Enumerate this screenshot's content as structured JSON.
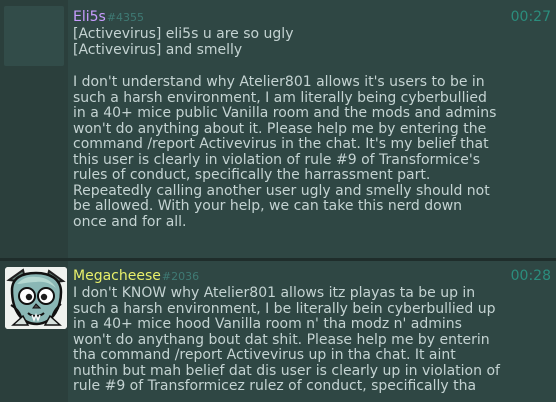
{
  "posts": [
    {
      "author": "Eli5s",
      "user_id": "#4355",
      "time": "00:27",
      "quotes": [
        "[Activevirus] eli5s u are so ugly",
        "[Activevirus] and smelly"
      ],
      "body": "I don't understand why Atelier801 allows it's users to be in\nsuch a harsh environment, I am literally being cyberbullied\nin a 40+ mice public Vanilla room and the mods and admins\nwon't do anything about it. Please help me by entering the\ncommand /report Activevirus in the chat. It's my belief that\nthis user is clearly in violation of rule #9 of Transformice's\nrules of conduct, specifically the harrassment part.\nRepeatedly calling another user ugly and smelly should not\nbe allowed. With your help, we can take this nerd down\nonce and for all."
    },
    {
      "author": "Megacheese",
      "user_id": "#2036",
      "time": "00:28",
      "body": "I don't KNOW why Atelier801 allows itz playas ta be up in\nsuch a harsh environment, I be literally bein cyberbullied up\nin a 40+ mice hood Vanilla room n' tha modz n' admins\nwon't do anythang bout dat shit. Please help me by enterin\ntha command /report Activevirus up in tha chat. It aint\nnuthin but mah belief dat dis user is clearly up in violation of\nrule #9 of Transformicez rulez of conduct, specifically tha"
    }
  ],
  "colors": {
    "background": "#2f4744",
    "author_1": "#c89cff",
    "author_2": "#e8ef6a",
    "time": "#2b8d7d",
    "text": "#c4d3d2"
  },
  "icons": {
    "avatar_2": "cartoon-mouse-avatar"
  }
}
